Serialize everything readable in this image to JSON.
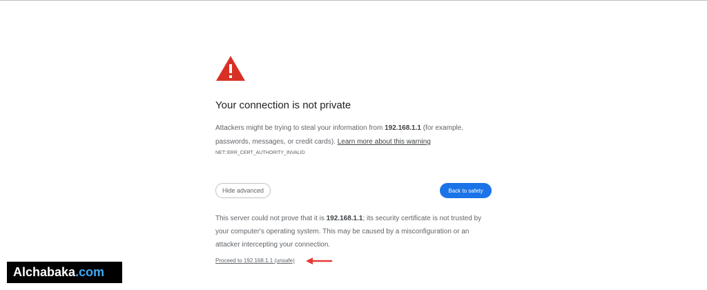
{
  "page": {
    "heading": "Your connection is not private",
    "message": {
      "part1": "Attackers might be trying to steal your information from ",
      "host": "192.168.1.1",
      "part2": " (for example, passwords, messages, or credit cards). ",
      "learn_more": "Learn more about this warning"
    },
    "error_code": "NET::ERR_CERT_AUTHORITY_INVALID",
    "buttons": {
      "hide_advanced": "Hide advanced",
      "back_to_safety": "Back to safety"
    },
    "details": {
      "part1": "This server could not prove that it is ",
      "host": "192.168.1.1",
      "part2": "; its security certificate is not trusted by your computer's operating system. This may be caused by a misconfiguration or an attacker intercepting your connection."
    },
    "proceed_link": "Proceed to 192.168.1.1 (unsafe)"
  },
  "icons": {
    "warning": "warning-triangle-icon",
    "annotation_arrow": "arrow-left-icon"
  },
  "watermark": {
    "name": "Alchabaka",
    "tld": ".com"
  },
  "colors": {
    "warning_red": "#d93025",
    "primary_blue": "#1a73e8",
    "annotation_red": "#e53935",
    "watermark_bg": "#000000",
    "watermark_tld": "#3fa9f5"
  }
}
